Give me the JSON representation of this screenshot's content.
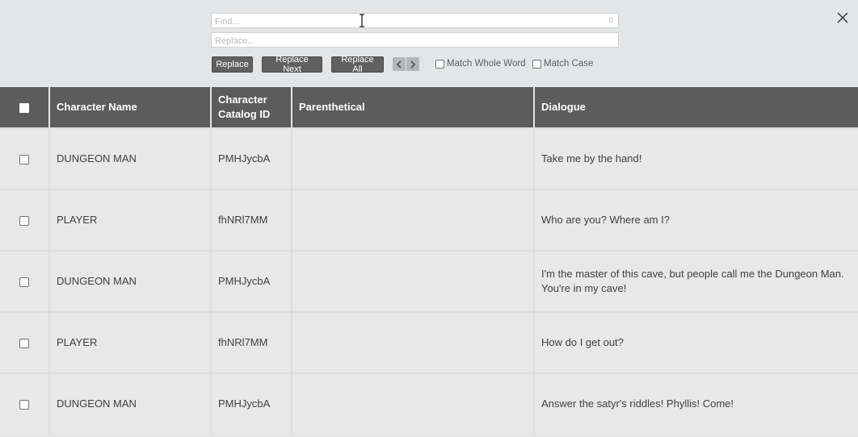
{
  "find": {
    "placeholder": "Find...",
    "count": "0"
  },
  "replace": {
    "placeholder": "Replace..."
  },
  "buttons": {
    "replace": "Replace",
    "replace_next": "Replace Next",
    "replace_all": "Replace All"
  },
  "options": {
    "match_whole_word": "Match Whole Word",
    "match_case": "Match Case"
  },
  "table": {
    "headers": {
      "character_name": "Character Name",
      "catalog_id_line1": "Character",
      "catalog_id_line2": "Catalog ID",
      "parenthetical": "Parenthetical",
      "dialogue": "Dialogue"
    },
    "rows": [
      {
        "name": "DUNGEON MAN",
        "id": "PMHJycbA",
        "parenthetical": "",
        "dialogue_line1": "Take me by the hand!",
        "dialogue_line2": ""
      },
      {
        "name": "PLAYER",
        "id": "fhNRl7MM",
        "parenthetical": "",
        "dialogue_line1": "Who are you? Where am I?",
        "dialogue_line2": ""
      },
      {
        "name": "DUNGEON MAN",
        "id": "PMHJycbA",
        "parenthetical": "",
        "dialogue_line1": "I'm the master of this cave, but people call me the Dungeon Man.",
        "dialogue_line2": "You're in my cave!"
      },
      {
        "name": "PLAYER",
        "id": "fhNRl7MM",
        "parenthetical": "",
        "dialogue_line1": "How do I get out?",
        "dialogue_line2": ""
      },
      {
        "name": "DUNGEON MAN",
        "id": "PMHJycbA",
        "parenthetical": "",
        "dialogue_line1": "Answer the satyr's riddles! Phyllis! Come!",
        "dialogue_line2": ""
      }
    ]
  }
}
